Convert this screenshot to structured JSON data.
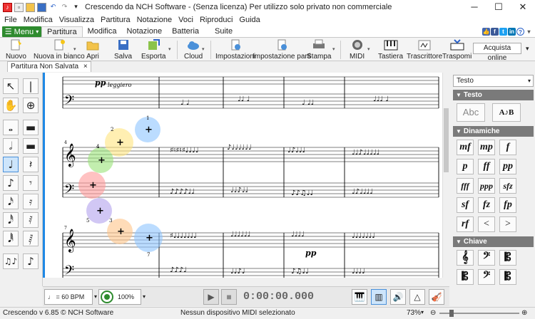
{
  "titlebar": {
    "title": "Crescendo da NCH Software - (Senza licenza) Per utilizzo solo privato non commerciale"
  },
  "menubar": {
    "items": [
      "File",
      "Modifica",
      "Visualizza",
      "Partitura",
      "Notazione",
      "Voci",
      "Riproduci",
      "Guida"
    ]
  },
  "ribbon_tabs": {
    "menu_label": "Menu",
    "tabs": [
      "Partitura",
      "Modifica",
      "Notazione",
      "Batteria",
      "Suite"
    ]
  },
  "toolbar": {
    "buttons": [
      "Nuovo",
      "Nuova in bianco",
      "Apri",
      "Salva",
      "Esporta",
      "Cloud",
      "Impostazioni",
      "Impostazione parti",
      "Stampa",
      "MIDI",
      "Tastiera",
      "Trascrittore",
      "Traspomi"
    ],
    "buy_label": "Acquista online"
  },
  "doc_tab": {
    "label": "Partitura Non Salvata",
    "close": "×"
  },
  "score": {
    "dyn_pp1": "pp",
    "leggiero": "leggiero",
    "dyn_pp2": "pp",
    "finger_2": "2",
    "finger_1": "1",
    "finger_4": "4",
    "finger_5": "5",
    "finger_3": "3",
    "finger_7": "7",
    "measure_4": "4",
    "measure_7": "7"
  },
  "panel": {
    "selector": "Testo",
    "sections": [
      "Testo",
      "Dinamiche",
      "Chiave"
    ],
    "dynamics": [
      "mf",
      "mp",
      "f",
      "p",
      "ff",
      "pp",
      "fff",
      "ppp",
      "sfz",
      "sf",
      "fz",
      "fp",
      "rf",
      "<",
      ">"
    ]
  },
  "transport": {
    "tempo": "♩ = 60 BPM",
    "volume": "100%",
    "time": "0:00:00.000"
  },
  "statusbar": {
    "version": "Crescendo v 6.85 © NCH Software",
    "midi": "Nessun dispositivo MIDI selezionato",
    "zoom": "73%"
  }
}
